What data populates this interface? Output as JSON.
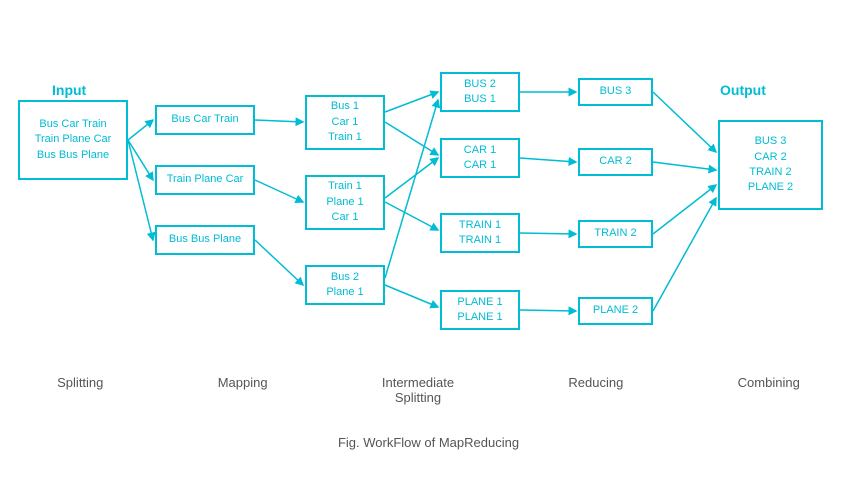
{
  "title": "Fig. WorkFlow of MapReducing",
  "labels": {
    "input": "Input",
    "output": "Output",
    "splitting": "Splitting",
    "mapping": "Mapping",
    "intermediate_splitting": "Intermediate\nSplitting",
    "reducing": "Reducing",
    "combining": "Combining",
    "caption": "Fig. WorkFlow of MapReducing"
  },
  "boxes": {
    "input": "Bus Car Train\nTrain Plane Car\nBus Bus Plane",
    "split1": "Bus Car Train",
    "split2": "Train Plane Car",
    "split3": "Bus Bus Plane",
    "map1": "Bus 1\nCar 1\nTrain 1",
    "map2": "Train 1\nPlane 1\nCar 1",
    "map3": "Bus 2\nPlane 1",
    "inter1": "BUS 2\nBUS 1",
    "inter2": "CAR 1\nCAR 1",
    "inter3": "TRAIN 1\nTRAIN 1",
    "inter4": "PLANE 1\nPLANE 1",
    "reduce1": "BUS 3",
    "reduce2": "CAR 2",
    "reduce3": "TRAIN 2",
    "reduce4": "PLANE 2",
    "output": "BUS 3\nCAR 2\nTRAIN 2\nPLANE 2"
  }
}
